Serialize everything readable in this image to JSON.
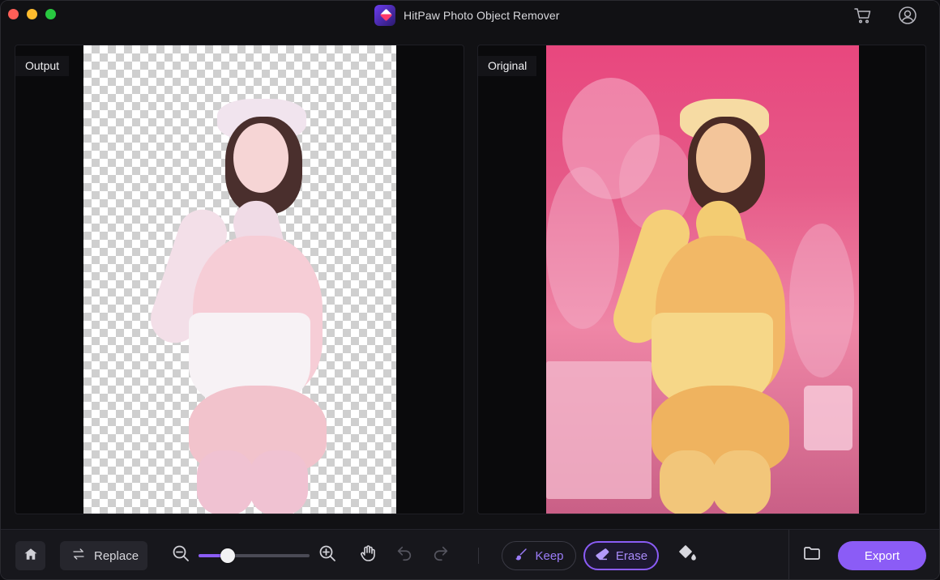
{
  "window": {
    "title": "HitPaw Photo Object Remover",
    "icons": [
      "cart-icon",
      "user-icon"
    ]
  },
  "panels": {
    "left": {
      "label": "Output"
    },
    "right": {
      "label": "Original"
    }
  },
  "toolbar": {
    "home_icon": "home-icon",
    "replace_label": "Replace",
    "zoom": {
      "level_fraction": 0.26
    },
    "keep_label": "Keep",
    "erase_label": "Erase",
    "export_label": "Export",
    "active_mode": "Erase"
  },
  "colors": {
    "accent": "#8b5cf6",
    "background": "#111114",
    "toolbar": "#17171c"
  }
}
